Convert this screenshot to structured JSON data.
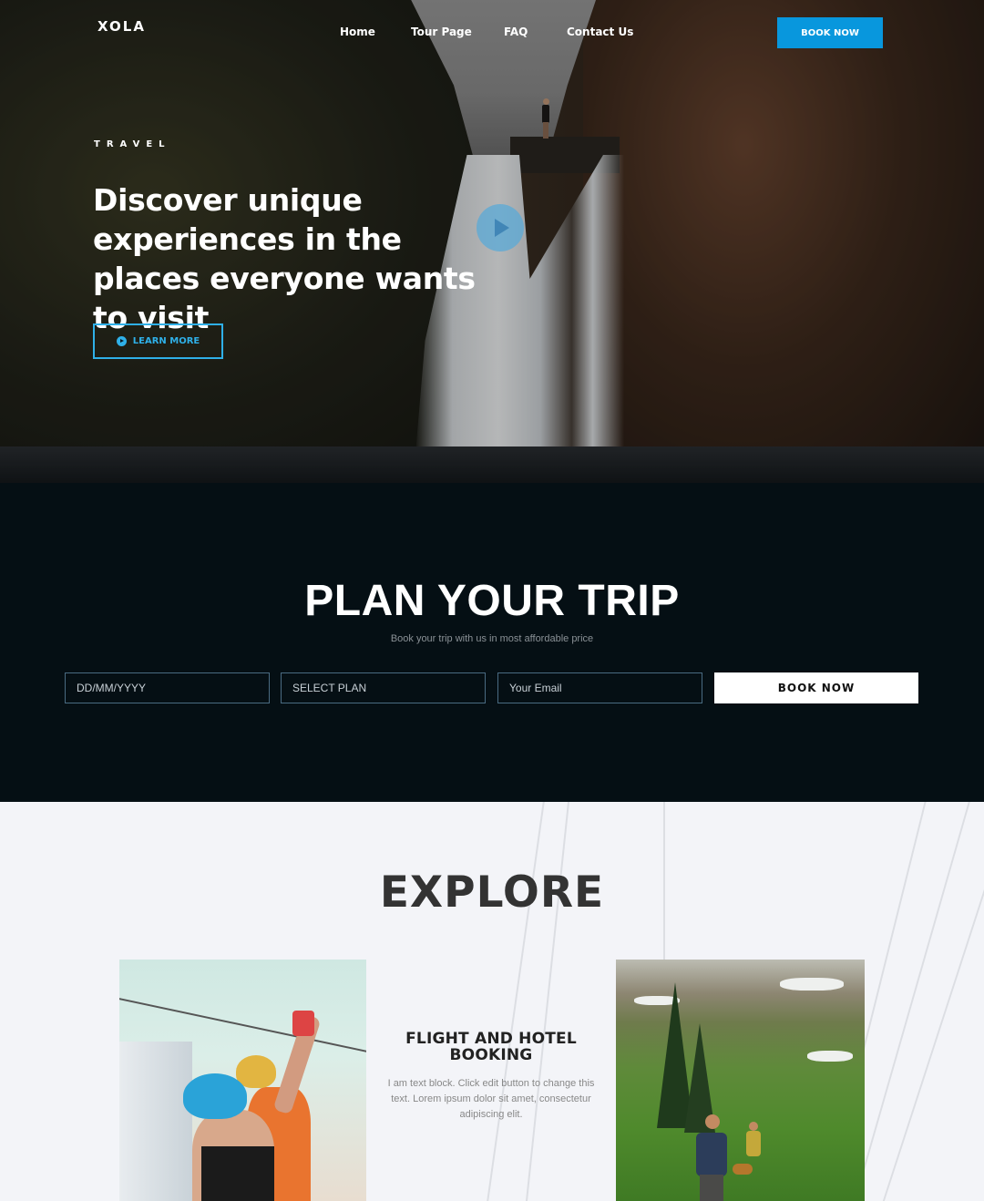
{
  "header": {
    "logo": "XOLA",
    "nav": [
      {
        "label": "Home"
      },
      {
        "label": "Tour Page"
      },
      {
        "label": "FAQ"
      },
      {
        "label": "Contact Us"
      }
    ],
    "cta_label": "BOOK NOW",
    "cta_color": "#0897dd"
  },
  "hero": {
    "eyebrow": "TRAVEL",
    "headline": "Discover unique experiences in the places everyone wants to visit",
    "play_icon": "play-icon",
    "learn_more_label": "LEARN MORE",
    "accent_color": "#2fb0e8"
  },
  "plan": {
    "title": "PLAN YOUR TRIP",
    "subtitle": "Book your trip with us in most affordable price",
    "date_placeholder": "DD/MM/YYYY",
    "plan_placeholder": "SELECT PLAN",
    "email_placeholder": "Your Email",
    "submit_label": "BOOK NOW",
    "background": "#050f14"
  },
  "explore": {
    "title": "EXPLORE",
    "card": {
      "title": "FLIGHT AND HOTEL BOOKING",
      "body": "I am text block. Click edit button to change this text. Lorem ipsum dolor sit amet, consectetur adipiscing elit."
    }
  }
}
